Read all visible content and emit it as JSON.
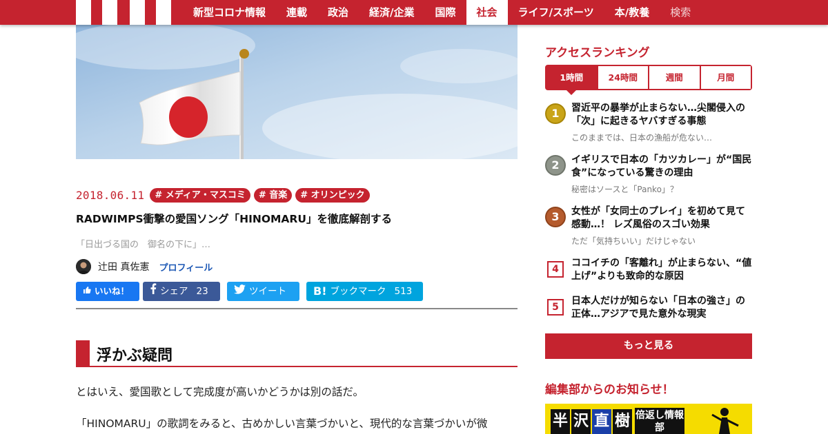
{
  "header": {
    "nav": [
      {
        "label": "新型コロナ情報"
      },
      {
        "label": "連載"
      },
      {
        "label": "政治"
      },
      {
        "label": "経済/企業"
      },
      {
        "label": "国際"
      },
      {
        "label": "社会",
        "active": true
      },
      {
        "label": "ライフ/スポーツ"
      },
      {
        "label": "本/教養"
      },
      {
        "label": "検索"
      }
    ]
  },
  "article": {
    "date": "2018.06.11",
    "tags": [
      "# メディア・マスコミ",
      "# 音楽",
      "# オリンピック"
    ],
    "title": "RADWIMPS衝撃の愛国ソング「HINOMARU」を徹底解剖する",
    "lead": "「日出づる国の　御名の下に」…",
    "author": {
      "name": "辻田 真佐憲",
      "profile_label": "プロフィール"
    },
    "share": {
      "like_label": "いいね！",
      "facebook_label": "シェア",
      "facebook_count": "23",
      "twitter_label": "ツイート",
      "hatena_label": "ブックマーク",
      "hatena_count": "513"
    },
    "section_title": "浮かぶ疑問",
    "paragraphs": [
      "とはいえ、愛国歌として完成度が高いかどうかは別の話だ。",
      "「HINOMARU」の歌詞をみると、古めかしい言葉づかいと、現代的な言葉づかいが微"
    ]
  },
  "sidebar": {
    "ranking_title": "アクセスランキング",
    "tabs": [
      {
        "label": "1時間",
        "active": true
      },
      {
        "label": "24時間"
      },
      {
        "label": "週間"
      },
      {
        "label": "月間"
      }
    ],
    "ranking": [
      {
        "rank": "1",
        "title": "習近平の暴挙が止まらない…尖閣侵入の「次」に起きるヤバすぎる事態",
        "subtitle": "このままでは、日本の漁船が危ない…"
      },
      {
        "rank": "2",
        "title": "イギリスで日本の「カツカレー」が“国民食”になっている驚きの理由",
        "subtitle": "秘密はソースと「Panko」？"
      },
      {
        "rank": "3",
        "title": "女性が「女同士のプレイ」を初めて見て感動…！ レズ風俗のスゴい効果",
        "subtitle": "ただ「気持ちいい」だけじゃない"
      },
      {
        "rank": "4",
        "title": "ココイチの「客離れ」が止まらない、“値上げ”よりも致命的な原因",
        "subtitle": ""
      },
      {
        "rank": "5",
        "title": "日本人だけが知らない「日本の強さ」の正体…アジアで見た意外な現実",
        "subtitle": ""
      }
    ],
    "more_label": "もっと見る",
    "notice_title": "編集部からのお知らせ！",
    "banner": {
      "chars": [
        "半",
        "沢",
        "直",
        "樹"
      ],
      "sub": "倍返し情報部"
    }
  },
  "colors": {
    "brand": "#c5232f",
    "facebook": "#3b5998",
    "twitter": "#1da1f2",
    "hatena": "#00a4de",
    "like": "#1877f2"
  }
}
